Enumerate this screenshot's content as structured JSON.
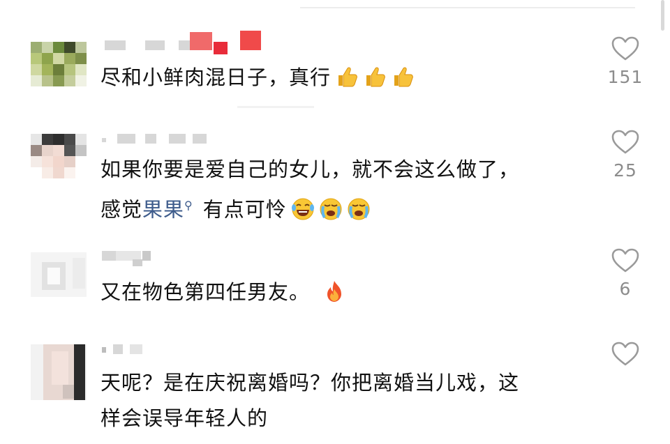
{
  "comments": [
    {
      "text": "尽和小鲜肉混日子，真行",
      "emojis": [
        "thumbs-up",
        "thumbs-up",
        "thumbs-up"
      ],
      "likes": "151"
    },
    {
      "text_line1": "如果你要是爱自己的女儿，就不会这么做了，",
      "text_line2_prefix": "感觉",
      "text_line2_link": "果果",
      "text_line2_suffix": "有点可怜",
      "emojis": [
        "laughing-crying-face",
        "crying-face",
        "crying-face"
      ],
      "likes": "25"
    },
    {
      "text": "又在物色第四任男友。",
      "emojis": [
        "fire"
      ],
      "likes": "6"
    },
    {
      "text_line1": "天呢？是在庆祝离婚吗？你把离婚当儿戏，这",
      "text_line2": "样会误导年轻人的",
      "likes": ""
    }
  ],
  "colors": {
    "text": "#111111",
    "link": "#3e5c8c",
    "like_count": "#8c8c8c",
    "heart_outline": "#9a9a9a"
  }
}
